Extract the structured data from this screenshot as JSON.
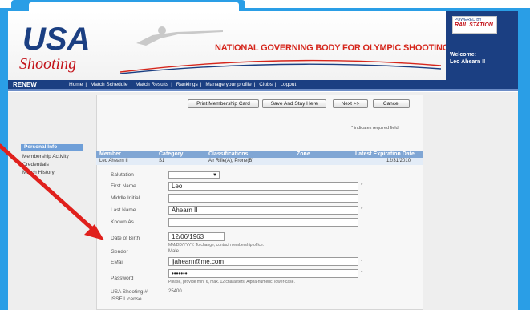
{
  "header": {
    "logo_text_top": "USA",
    "logo_text_bottom": "Shooting",
    "tagline": "NATIONAL GOVERNING BODY FOR OLYMPIC SHOOTING SPORTS",
    "powered_by": "POWERED BY",
    "powered_brand": "RAIL STATION",
    "welcome_label": "Welcome:",
    "welcome_name": "Leo Ahearn II"
  },
  "nav": {
    "renew": "RENEW",
    "links": [
      "Home",
      "Match Schedule",
      "Match Results",
      "Rankings",
      "Manage your profile",
      "Clubs",
      "Logout"
    ]
  },
  "sidebar": {
    "heading": "Personal Info",
    "items": [
      "Membership Activity",
      "Credentials",
      "Match History"
    ]
  },
  "buttons": {
    "print": "Print Membership Card",
    "save": "Save And Stay Here",
    "next": "Next >>",
    "cancel": "Cancel"
  },
  "required_note": "* indicates required field",
  "table": {
    "headers": [
      "Member",
      "Category",
      "Classifications",
      "Zone",
      "Latest Expiration Date"
    ],
    "row": [
      "Leo Ahearn II",
      "S1",
      "Air Rifle(A), Prone(B)",
      "",
      "12/31/2010"
    ]
  },
  "form": {
    "salutation_label": "Salutation",
    "first_name_label": "First Name",
    "first_name_value": "Leo",
    "middle_label": "Middle Initial",
    "last_name_label": "Last Name",
    "last_name_value": "Ahearn II",
    "known_as_label": "Known As",
    "dob_label": "Date of Birth",
    "dob_value": "12/06/1963",
    "dob_hint": "MM/DD/YYYY. To change, contact membership office.",
    "gender_label": "Gender",
    "gender_value": "Male",
    "email_label": "EMail",
    "email_value": "ljahearn@me.com",
    "password_label": "Password",
    "password_value": "•••••••",
    "password_hint": "Please, provide min. 6, max. 12 characters. Alpha-numeric, lower-case.",
    "usa_shooting_label": "USA Shooting #",
    "usa_shooting_value": "25400",
    "issf_label": "ISSF License",
    "required_star": "*"
  },
  "colors": {
    "frame": "#2a9ee6",
    "nav": "#1b3f82",
    "tagline": "#d5261c",
    "arrow": "#e0201c",
    "table_header": "#80a6d4"
  }
}
